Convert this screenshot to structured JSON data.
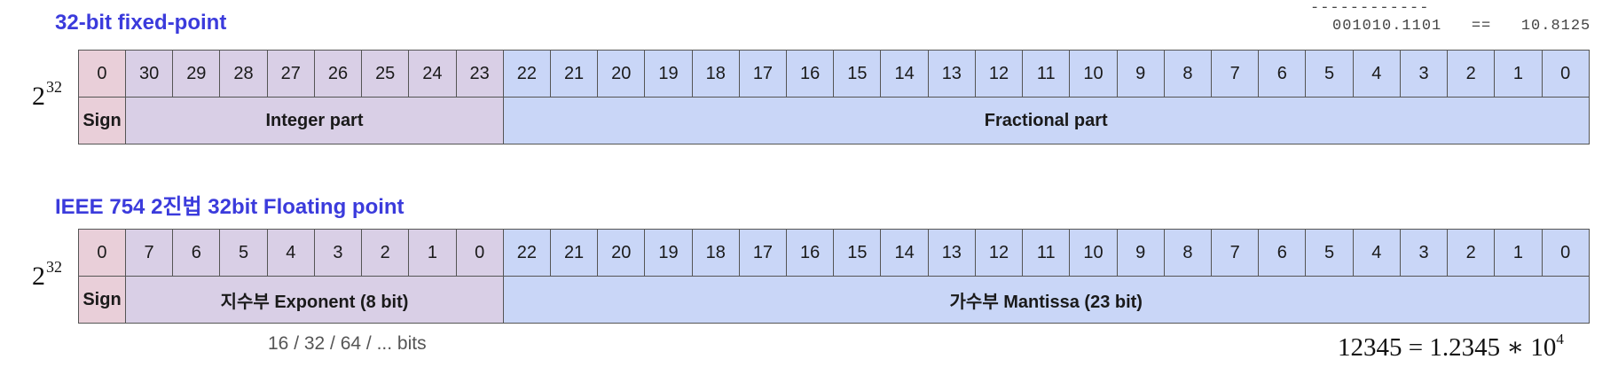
{
  "annotation": {
    "dashes": "------------",
    "binary": "001010.1101",
    "operator": "==",
    "decimal": "10.8125"
  },
  "fixed_point": {
    "title": "32-bit fixed-point",
    "power_base": "2",
    "power_exp": "32",
    "bits": [
      "0",
      "30",
      "29",
      "28",
      "27",
      "26",
      "25",
      "24",
      "23",
      "22",
      "21",
      "20",
      "19",
      "18",
      "17",
      "16",
      "15",
      "14",
      "13",
      "12",
      "11",
      "10",
      "9",
      "8",
      "7",
      "6",
      "5",
      "4",
      "3",
      "2",
      "1",
      "0"
    ],
    "sign_label": "Sign",
    "integer_label": "Integer part",
    "fraction_label": "Fractional part"
  },
  "floating_point": {
    "title": "IEEE 754 2진법 32bit Floating point",
    "power_base": "2",
    "power_exp": "32",
    "bits": [
      "0",
      "7",
      "6",
      "5",
      "4",
      "3",
      "2",
      "1",
      "0",
      "22",
      "21",
      "20",
      "19",
      "18",
      "17",
      "16",
      "15",
      "14",
      "13",
      "12",
      "11",
      "10",
      "9",
      "8",
      "7",
      "6",
      "5",
      "4",
      "3",
      "2",
      "1",
      "0"
    ],
    "sign_label": "Sign",
    "exponent_label": "지수부 Exponent (8 bit)",
    "mantissa_label": "가수부 Mantissa (23 bit)"
  },
  "footer": {
    "bits_note": "16 / 32 / 64 / ... bits",
    "formula_lhs": "12345 = 1.2345 ∗ 10",
    "formula_exp": "4"
  },
  "colors": {
    "sign": "#e9cfd9",
    "integer": "#d9cfe6",
    "fraction": "#c9d6f7",
    "title": "#3b3bdc"
  }
}
